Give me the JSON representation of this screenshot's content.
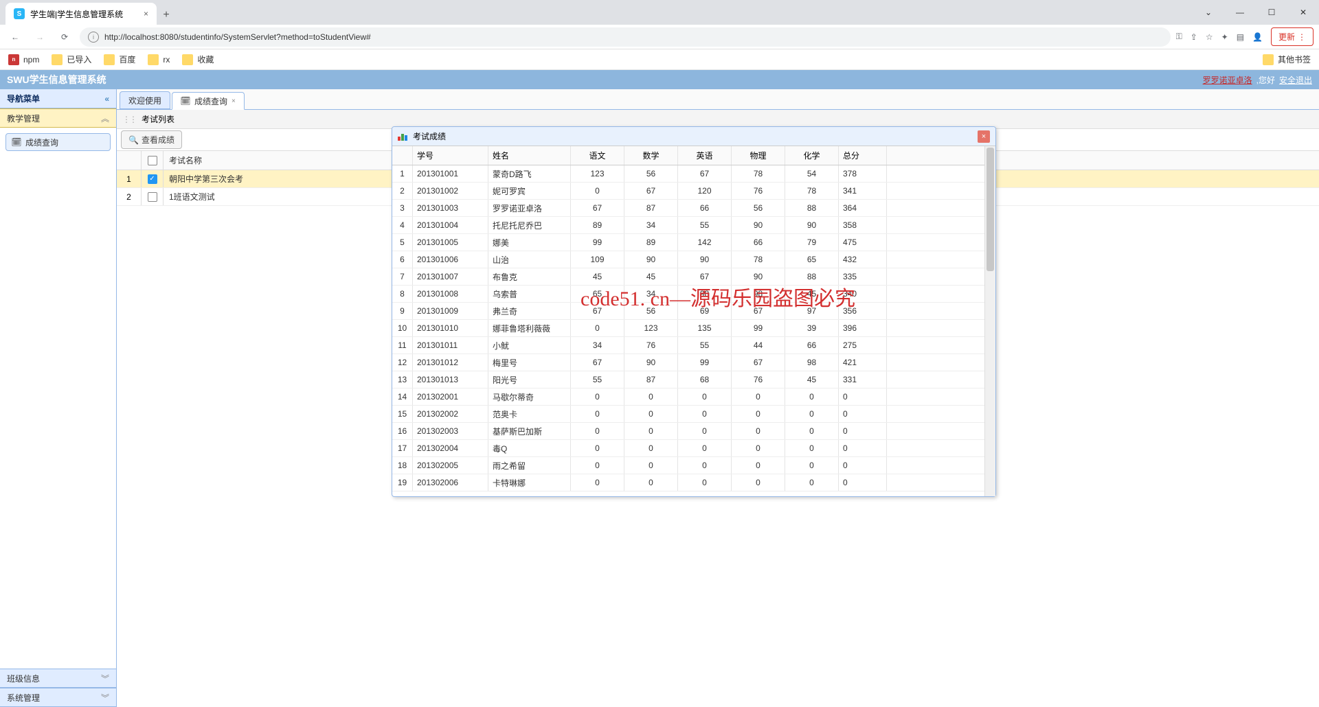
{
  "browser": {
    "tab_title": "学生端|学生信息管理系统",
    "url": "http://localhost:8080/studentinfo/SystemServlet?method=toStudentView#",
    "update_label": "更新",
    "bookmarks": [
      "npm",
      "已导入",
      "百度",
      "rx",
      "收藏"
    ],
    "other_bookmarks": "其他书签"
  },
  "app": {
    "title": "SWU学生信息管理系统",
    "user_name": "罗罗诺亚卓洛",
    "greeting": ",您好",
    "logout": "安全退出"
  },
  "sidebar": {
    "nav_title": "导航菜单",
    "sections": {
      "teaching": "教学管理",
      "class_info": "班级信息",
      "system": "系统管理"
    },
    "tree_item": "成绩查询"
  },
  "tabs": {
    "welcome": "欢迎使用",
    "score_query": "成绩查询"
  },
  "toolbar": {
    "exam_list": "考试列表",
    "view_score": "查看成绩"
  },
  "exam_table": {
    "header": "考试名称",
    "rows": [
      {
        "n": "1",
        "name": "朝阳中学第三次会考",
        "checked": true
      },
      {
        "n": "2",
        "name": "1班语文测试",
        "checked": false
      }
    ]
  },
  "dialog": {
    "title": "考试成绩",
    "columns": [
      "学号",
      "姓名",
      "语文",
      "数学",
      "英语",
      "物理",
      "化学",
      "总分"
    ],
    "rows": [
      {
        "i": 1,
        "id": "201301001",
        "name": "蒙奇D路飞",
        "s": [
          123,
          56,
          67,
          78,
          54
        ],
        "t": 378
      },
      {
        "i": 2,
        "id": "201301002",
        "name": "妮可罗宾",
        "s": [
          0,
          67,
          120,
          76,
          78
        ],
        "t": 341
      },
      {
        "i": 3,
        "id": "201301003",
        "name": "罗罗诺亚卓洛",
        "s": [
          67,
          87,
          66,
          56,
          88
        ],
        "t": 364
      },
      {
        "i": 4,
        "id": "201301004",
        "name": "托尼托尼乔巴",
        "s": [
          89,
          34,
          55,
          90,
          90
        ],
        "t": 358
      },
      {
        "i": 5,
        "id": "201301005",
        "name": "娜美",
        "s": [
          99,
          89,
          142,
          66,
          79
        ],
        "t": 475
      },
      {
        "i": 6,
        "id": "201301006",
        "name": "山治",
        "s": [
          109,
          90,
          90,
          78,
          65
        ],
        "t": 432
      },
      {
        "i": 7,
        "id": "201301007",
        "name": "布鲁克",
        "s": [
          45,
          45,
          67,
          90,
          88
        ],
        "t": 335
      },
      {
        "i": 8,
        "id": "201301008",
        "name": "乌索普",
        "s": [
          65,
          34,
          98,
          98,
          45
        ],
        "t": 340
      },
      {
        "i": 9,
        "id": "201301009",
        "name": "弗兰奇",
        "s": [
          67,
          56,
          69,
          67,
          97
        ],
        "t": 356
      },
      {
        "i": 10,
        "id": "201301010",
        "name": "娜菲鲁塔利薇薇",
        "s": [
          0,
          123,
          135,
          99,
          39
        ],
        "t": 396
      },
      {
        "i": 11,
        "id": "201301011",
        "name": "小鱿",
        "s": [
          34,
          76,
          55,
          44,
          66
        ],
        "t": 275
      },
      {
        "i": 12,
        "id": "201301012",
        "name": "梅里号",
        "s": [
          67,
          90,
          99,
          67,
          98
        ],
        "t": 421
      },
      {
        "i": 13,
        "id": "201301013",
        "name": "阳光号",
        "s": [
          55,
          87,
          68,
          76,
          45
        ],
        "t": 331
      },
      {
        "i": 14,
        "id": "201302001",
        "name": "马歇尔蒂奇",
        "s": [
          0,
          0,
          0,
          0,
          0
        ],
        "t": 0
      },
      {
        "i": 15,
        "id": "201302002",
        "name": "范奥卡",
        "s": [
          0,
          0,
          0,
          0,
          0
        ],
        "t": 0
      },
      {
        "i": 16,
        "id": "201302003",
        "name": "基萨斯巴加斯",
        "s": [
          0,
          0,
          0,
          0,
          0
        ],
        "t": 0
      },
      {
        "i": 17,
        "id": "201302004",
        "name": "毒Q",
        "s": [
          0,
          0,
          0,
          0,
          0
        ],
        "t": 0
      },
      {
        "i": 18,
        "id": "201302005",
        "name": "雨之希留",
        "s": [
          0,
          0,
          0,
          0,
          0
        ],
        "t": 0
      },
      {
        "i": 19,
        "id": "201302006",
        "name": "卡特琳娜",
        "s": [
          0,
          0,
          0,
          0,
          0
        ],
        "t": 0
      }
    ]
  },
  "watermark": "code51. cn—源码乐园盗图必究"
}
